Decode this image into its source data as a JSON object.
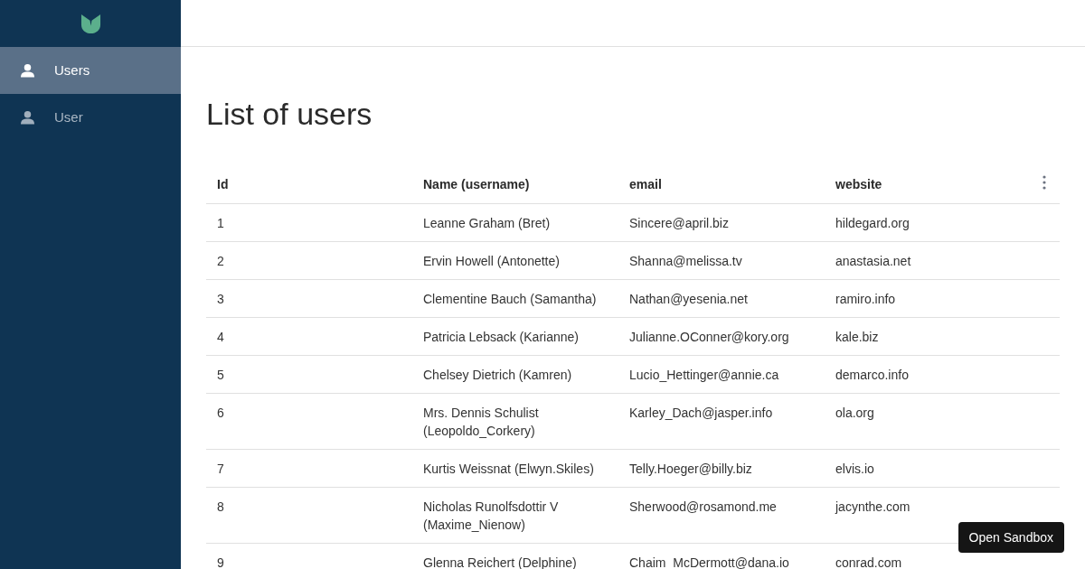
{
  "sidebar": {
    "items": [
      {
        "label": "Users",
        "selected": true
      },
      {
        "label": "User",
        "selected": false
      }
    ]
  },
  "title": "List of users",
  "table": {
    "columns": [
      "Id",
      "Name (username)",
      "email",
      "website"
    ],
    "rows": [
      [
        "1",
        "Leanne Graham (Bret)",
        "Sincere@april.biz",
        "hildegard.org"
      ],
      [
        "2",
        "Ervin Howell (Antonette)",
        "Shanna@melissa.tv",
        "anastasia.net"
      ],
      [
        "3",
        "Clementine Bauch (Samantha)",
        "Nathan@yesenia.net",
        "ramiro.info"
      ],
      [
        "4",
        "Patricia Lebsack (Karianne)",
        "Julianne.OConner@kory.org",
        "kale.biz"
      ],
      [
        "5",
        "Chelsey Dietrich (Kamren)",
        "Lucio_Hettinger@annie.ca",
        "demarco.info"
      ],
      [
        "6",
        "Mrs. Dennis Schulist (Leopoldo_Corkery)",
        "Karley_Dach@jasper.info",
        "ola.org"
      ],
      [
        "7",
        "Kurtis Weissnat (Elwyn.Skiles)",
        "Telly.Hoeger@billy.biz",
        "elvis.io"
      ],
      [
        "8",
        "Nicholas Runolfsdottir V (Maxime_Nienow)",
        "Sherwood@rosamond.me",
        "jacynthe.com"
      ],
      [
        "9",
        "Glenna Reichert (Delphine)",
        "Chaim_McDermott@dana.io",
        "conrad.com"
      ]
    ]
  },
  "sandbox_button": "Open Sandbox"
}
